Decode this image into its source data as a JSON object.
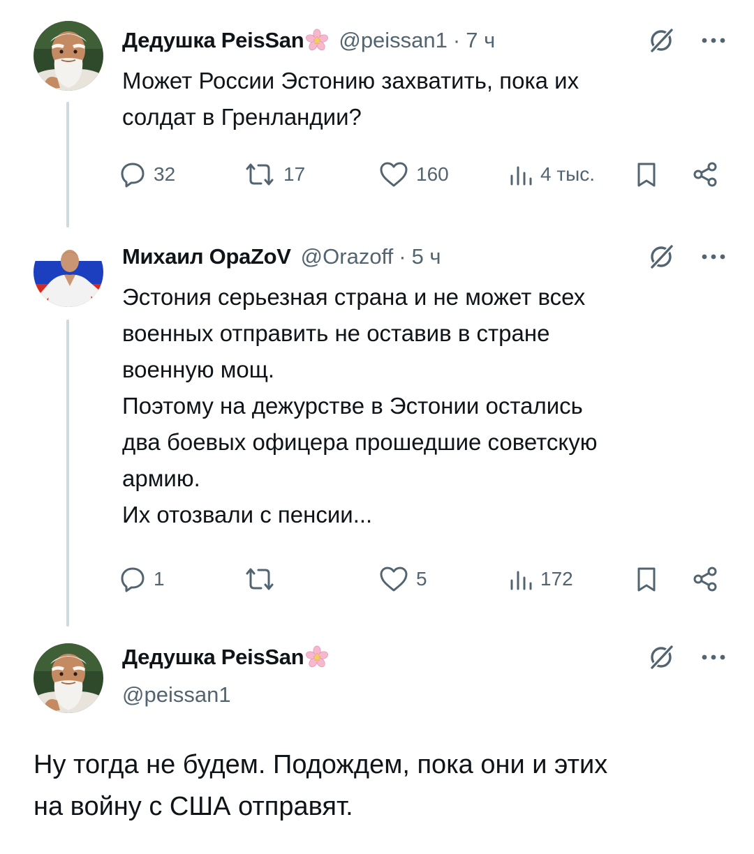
{
  "tweets": [
    {
      "name": "Дедушка PeisSan",
      "handle": "@peissan1",
      "separator": "·",
      "time": "7 ч",
      "text": [
        "Может России Эстонию захватить, пока их",
        "солдат в Гренландии?"
      ],
      "replies": "32",
      "reposts": "17",
      "likes": "160",
      "views": "4 тыс."
    },
    {
      "name": "Михаил OpaZoV",
      "handle": "@Orazoff",
      "separator": "·",
      "time": "5 ч",
      "text": [
        "Эстония серьезная страна и не может всех",
        "военных отправить не оставив в стране",
        "военную мощ.",
        "Поэтому на дежурстве в Эстонии остались",
        "два боевых офицера прошедшие советскую",
        "армию.",
        "Их отозвали с пенсии..."
      ],
      "replies": "1",
      "reposts": "",
      "likes": "5",
      "views": "172"
    }
  ],
  "reply": {
    "name": "Дедушка PeisSan",
    "handle": "@peissan1",
    "text": [
      "Ну тогда не будем. Подождем, пока они и этих",
      "на войну с США отправят."
    ]
  },
  "icons": {
    "flower": "cherry-blossom-emoji",
    "grok": "grok-icon",
    "more": "more-dots-icon",
    "reply": "reply-bubble-icon",
    "repost": "repost-icon",
    "like": "heart-icon",
    "views": "views-bars-icon",
    "bookmark": "bookmark-icon",
    "share": "share-icon"
  },
  "colors": {
    "text": "#0f1419",
    "secondary": "#536471",
    "thread_line": "#cfd9de",
    "flag_white": "#ffffff",
    "flag_blue": "#1c3fbf",
    "flag_red": "#d52b1e"
  }
}
